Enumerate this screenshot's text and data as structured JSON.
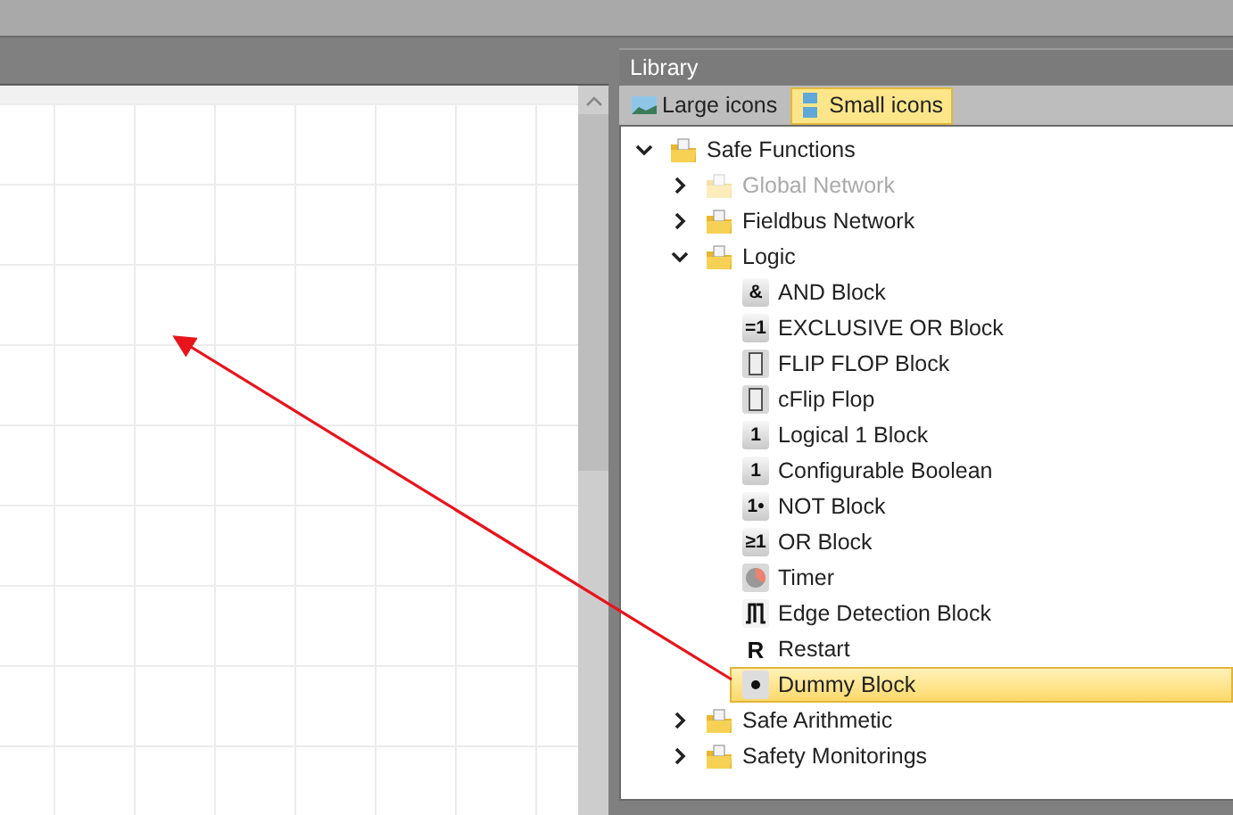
{
  "library": {
    "title": "Library",
    "view_buttons": [
      {
        "label": "Large icons",
        "selected": false
      },
      {
        "label": "Small icons",
        "selected": true
      }
    ],
    "tree": [
      {
        "label": "Safe Functions",
        "expanded": true,
        "disabled": false,
        "children": [
          {
            "label": "Global Network",
            "expanded": false,
            "disabled": true
          },
          {
            "label": "Fieldbus Network",
            "expanded": false,
            "disabled": false
          },
          {
            "label": "Logic",
            "expanded": true,
            "disabled": false,
            "children": [
              {
                "kind": "glyph",
                "glyph": "&",
                "label": "AND Block",
                "selected": false
              },
              {
                "kind": "glyph",
                "glyph": "=1",
                "label": "EXCLUSIVE OR Block",
                "selected": false
              },
              {
                "kind": "flipflop",
                "label": "FLIP FLOP Block",
                "selected": false
              },
              {
                "kind": "flipflop",
                "label": "cFlip Flop",
                "selected": false
              },
              {
                "kind": "glyph",
                "glyph": "1",
                "label": "Logical 1 Block",
                "selected": false
              },
              {
                "kind": "glyph",
                "glyph": "1",
                "label": "Configurable Boolean",
                "selected": false
              },
              {
                "kind": "glyph",
                "glyph": "1•",
                "label": "NOT Block",
                "selected": false
              },
              {
                "kind": "glyph",
                "glyph": "≥1",
                "label": "OR Block",
                "selected": false
              },
              {
                "kind": "timer",
                "label": "Timer",
                "selected": false
              },
              {
                "kind": "edge",
                "label": "Edge Detection Block",
                "selected": false
              },
              {
                "kind": "letter",
                "glyph": "R",
                "label": "Restart",
                "selected": false
              },
              {
                "kind": "dot",
                "label": "Dummy Block",
                "selected": true
              }
            ]
          },
          {
            "label": "Safe Arithmetic",
            "expanded": false,
            "disabled": false
          },
          {
            "label": "Safety Monitorings",
            "expanded": false,
            "disabled": false
          }
        ]
      }
    ]
  }
}
